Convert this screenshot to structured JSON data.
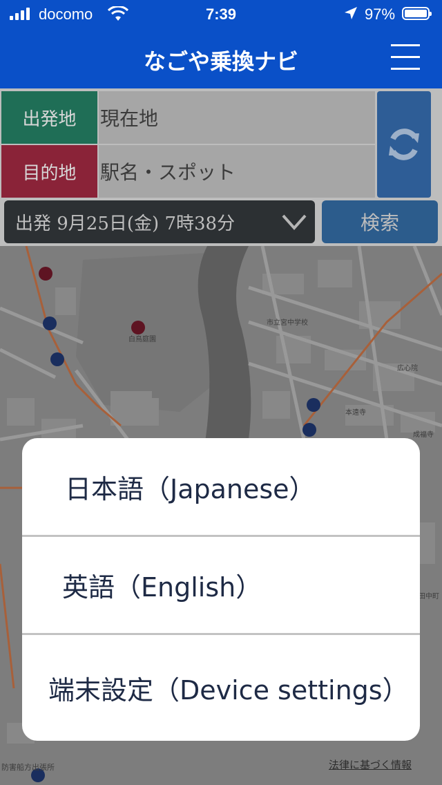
{
  "status_bar": {
    "carrier": "docomo",
    "time": "7:39",
    "battery": "97%"
  },
  "nav": {
    "title": "なごや乗換ナビ"
  },
  "route_form": {
    "departure_label": "出発地",
    "departure_value": "現在地",
    "destination_label": "目的地",
    "destination_placeholder": "駅名・スポット",
    "datetime": "出発 9月25日(金) 7時38分",
    "search_label": "検索"
  },
  "map": {
    "labels": {
      "school": "市立宮中学校",
      "garden": "白鳥庭園",
      "temple1": "広心院",
      "temple2": "本遠寺",
      "temple3": "成福寺",
      "town": "田中町",
      "office": "防害船方出張所"
    },
    "legal_link": "法律に基づく情報"
  },
  "language_sheet": {
    "options": [
      "日本語（Japanese）",
      "英語（English）",
      "端末設定（Device settings）"
    ]
  },
  "colors": {
    "header": "#0a50c8",
    "departure": "#1f6e56",
    "destination": "#8a2338",
    "swap": "#2e5d96",
    "search": "#2c5c8c"
  }
}
